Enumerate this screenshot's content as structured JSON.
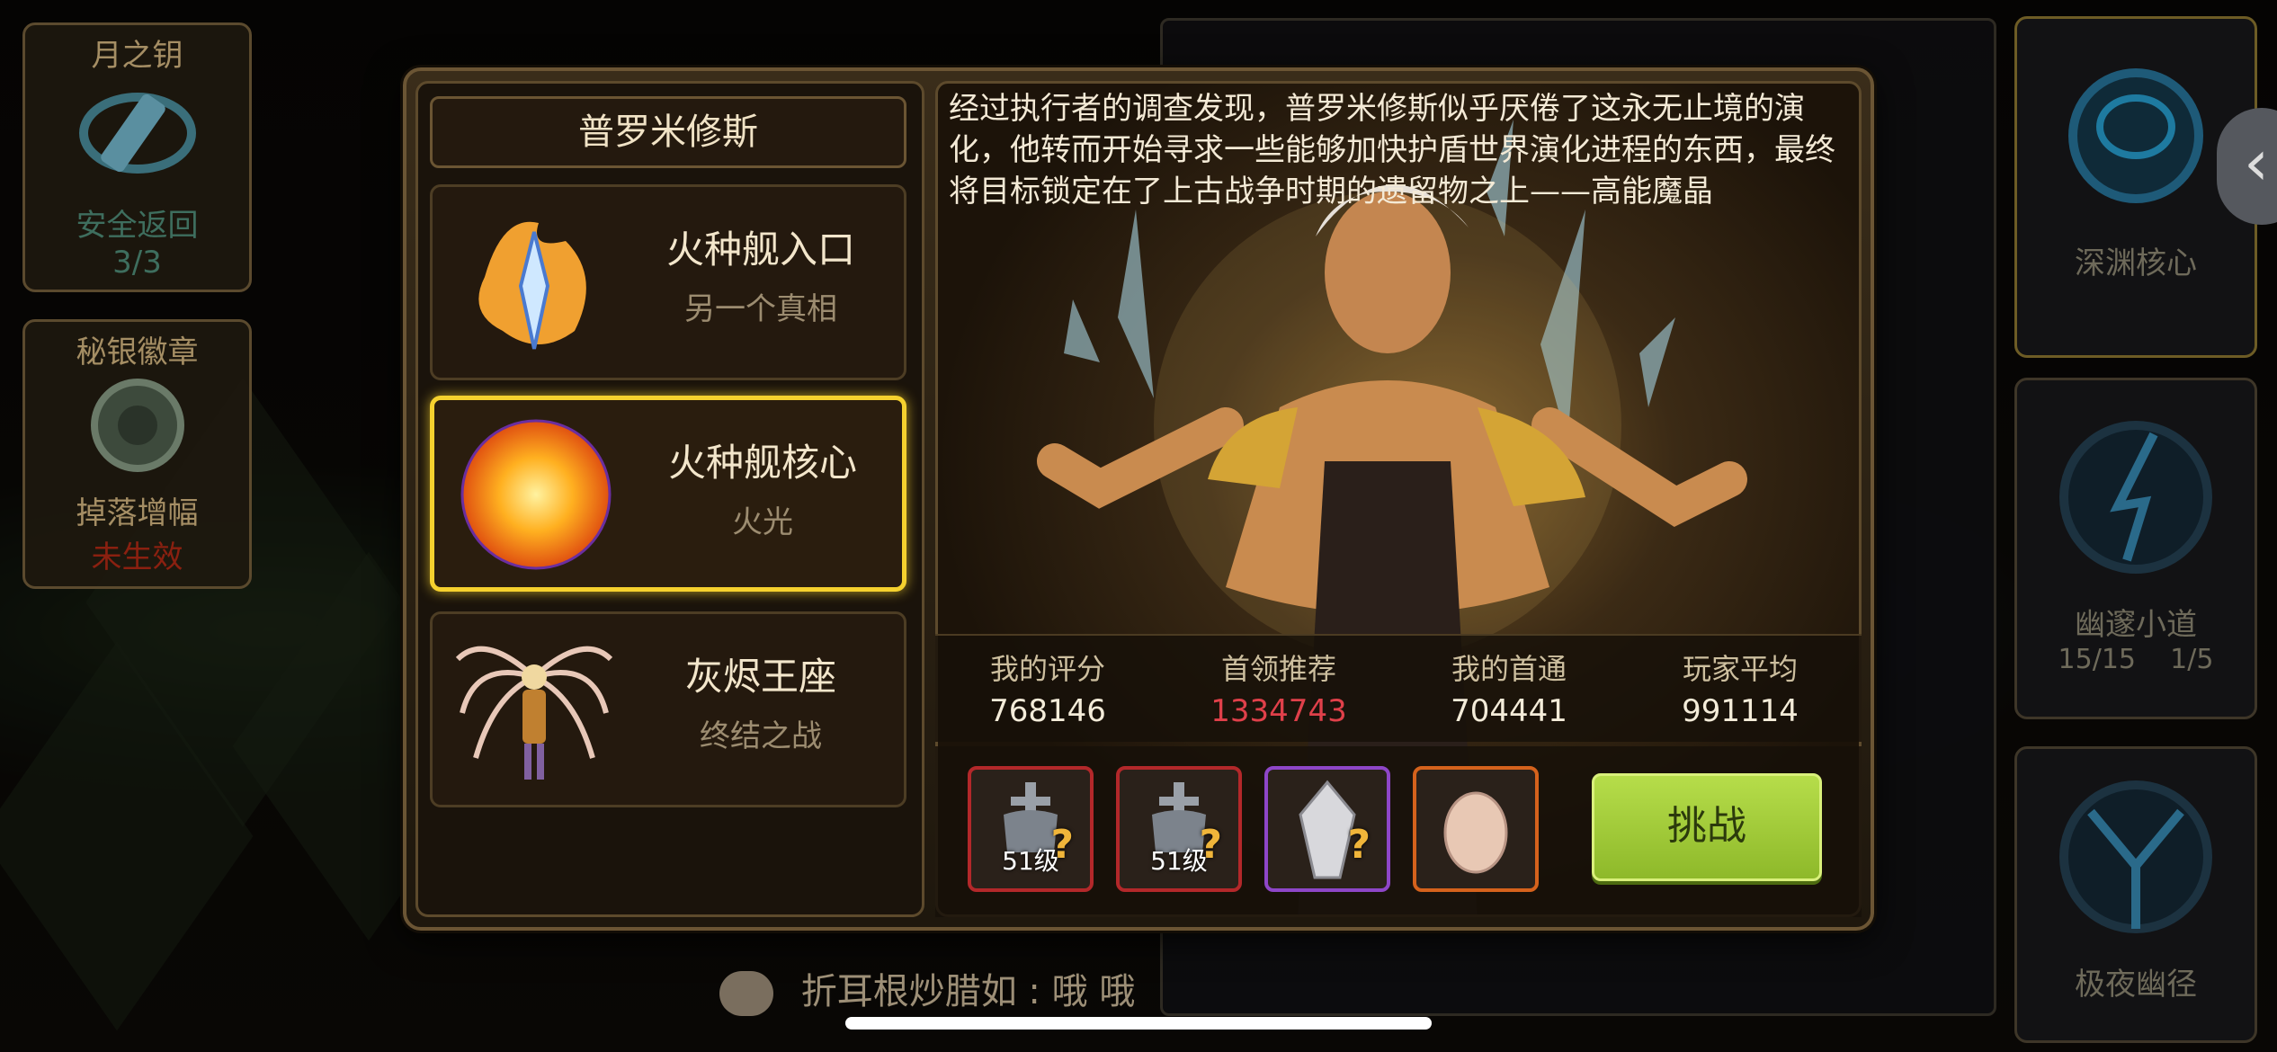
{
  "left_side": {
    "moon_key": {
      "title": "月之钥",
      "status": "安全返回",
      "count": "3/3"
    },
    "mithril_badge": {
      "title": "秘银徽章",
      "status": "掉落增幅",
      "state": "未生效"
    }
  },
  "right_side": {
    "abyss_core": "深渊核心",
    "dark_path": {
      "label": "幽邃小道",
      "stat1": "15/15",
      "stat2": "1/5"
    },
    "polar_night": "极夜幽径"
  },
  "boss": {
    "name": "普罗米修斯"
  },
  "stages": [
    {
      "name": "火种舰入口",
      "subtitle": "另一个真相",
      "icon": "fire-crystal-icon"
    },
    {
      "name": "火种舰核心",
      "subtitle": "火光",
      "icon": "fire-sun-icon",
      "selected": true
    },
    {
      "name": "灰烬王座",
      "subtitle": "终结之战",
      "icon": "winged-boss-icon"
    }
  ],
  "story": "经过执行者的调查发现，普罗米修斯似乎厌倦了这永无止境的演化，他转而开始寻求一些能够加快护盾世界演化进程的东西，最终将目标锁定在了上古战争时期的遗留物之上——高能魔晶",
  "stats": {
    "my_score": {
      "label": "我的评分",
      "value": "768146"
    },
    "first_recommend": {
      "label": "首领推荐",
      "value": "1334743"
    },
    "my_first_clear": {
      "label": "我的首通",
      "value": "704441"
    },
    "player_avg": {
      "label": "玩家平均",
      "value": "991114"
    }
  },
  "rewards": [
    {
      "type": "equipment",
      "level": "51级",
      "border": "#b3282a"
    },
    {
      "type": "equipment",
      "level": "51级",
      "border": "#b3282a"
    },
    {
      "type": "crystal",
      "level": "",
      "border": "#8e46c8"
    },
    {
      "type": "egg",
      "level": "",
      "border": "#d5621c"
    }
  ],
  "challenge_label": "挑战",
  "chat": {
    "text": "折耳根炒腊如 : 哦 哦"
  },
  "colors": {
    "selected_border": "#f5d12e",
    "challenge_green": "#a6cf3b",
    "recommend_red": "#e0404a"
  }
}
